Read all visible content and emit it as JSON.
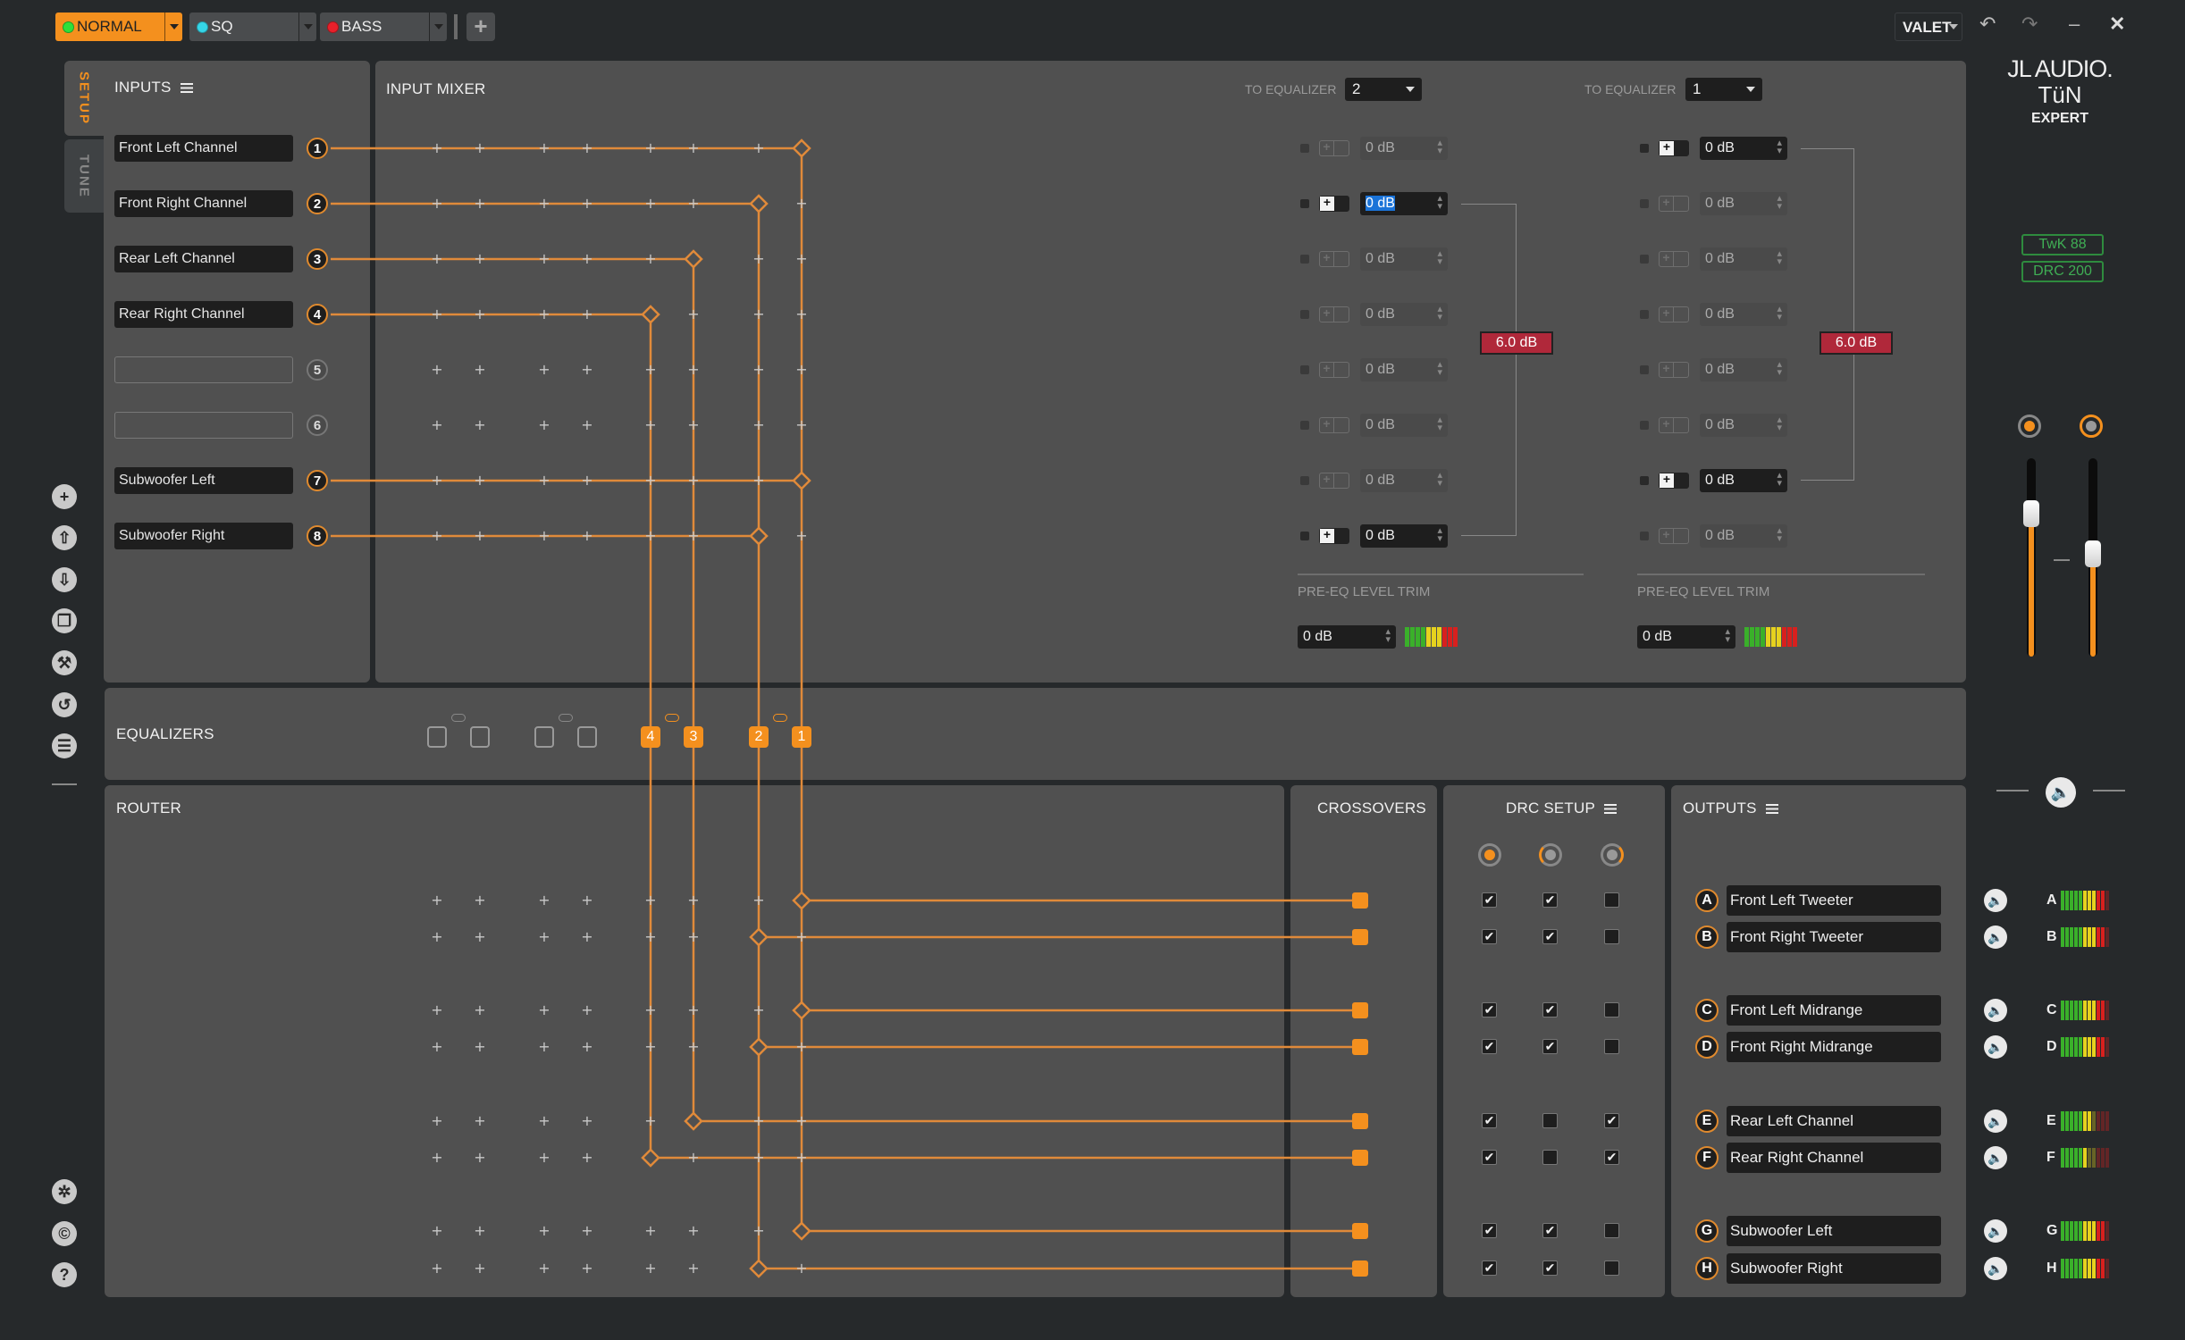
{
  "topbar": {
    "presets": [
      {
        "label": "NORMAL",
        "dot_color": "#2ee03a",
        "active": true
      },
      {
        "label": "SQ",
        "dot_color": "#35d6e8",
        "active": false
      },
      {
        "label": "BASS",
        "dot_color": "#e8202a",
        "active": false
      }
    ],
    "add_label": "+",
    "valet_label": "VALET",
    "undo_icon": "undo-icon",
    "redo_icon": "redo-icon",
    "minimize_label": "–",
    "close_label": "✕"
  },
  "brand": {
    "line1": "JL AUDIO.",
    "line2": "TüN",
    "line3": "EXPERT"
  },
  "device_badges": [
    "TwK 88",
    "DRC 200"
  ],
  "side_tabs": [
    {
      "label": "SETUP",
      "active": true
    },
    {
      "label": "TUNE",
      "active": false
    }
  ],
  "side_tools": [
    "add-icon",
    "upload-icon",
    "download-icon",
    "copy-icon",
    "wrench-icon",
    "reset-icon",
    "list-icon"
  ],
  "side_bottom": [
    {
      "icon": "settings-icon",
      "glyph": "✲"
    },
    {
      "icon": "copyright-icon",
      "glyph": "©"
    },
    {
      "icon": "help-icon",
      "glyph": "?"
    }
  ],
  "inputs": {
    "title": "INPUTS",
    "channels": [
      {
        "num": "1",
        "name": "Front Left Channel",
        "active": true
      },
      {
        "num": "2",
        "name": "Front Right Channel",
        "active": true
      },
      {
        "num": "3",
        "name": "Rear Left Channel",
        "active": true
      },
      {
        "num": "4",
        "name": "Rear Right Channel",
        "active": true
      },
      {
        "num": "5",
        "name": "",
        "active": false
      },
      {
        "num": "6",
        "name": "",
        "active": false
      },
      {
        "num": "7",
        "name": "Subwoofer Left",
        "active": true
      },
      {
        "num": "8",
        "name": "Subwoofer Right",
        "active": true
      }
    ]
  },
  "input_mixer": {
    "title": "INPUT MIXER",
    "groups": [
      {
        "to_label": "TO EQUALIZER",
        "selected": "2",
        "rows": [
          {
            "enabled": false,
            "value": "0 dB"
          },
          {
            "enabled": true,
            "value": "0 dB",
            "focused": true
          },
          {
            "enabled": false,
            "value": "0 dB"
          },
          {
            "enabled": false,
            "value": "0 dB"
          },
          {
            "enabled": false,
            "value": "0 dB"
          },
          {
            "enabled": false,
            "value": "0 dB"
          },
          {
            "enabled": false,
            "value": "0 dB"
          },
          {
            "enabled": true,
            "value": "0 dB"
          }
        ],
        "sum": "6.0 dB",
        "trim_label": "PRE-EQ LEVEL TRIM",
        "trim_value": "0 dB"
      },
      {
        "to_label": "TO EQUALIZER",
        "selected": "1",
        "rows": [
          {
            "enabled": true,
            "value": "0 dB"
          },
          {
            "enabled": false,
            "value": "0 dB"
          },
          {
            "enabled": false,
            "value": "0 dB"
          },
          {
            "enabled": false,
            "value": "0 dB"
          },
          {
            "enabled": false,
            "value": "0 dB"
          },
          {
            "enabled": false,
            "value": "0 dB"
          },
          {
            "enabled": true,
            "value": "0 dB"
          },
          {
            "enabled": false,
            "value": "0 dB"
          }
        ],
        "sum": "6.0 dB",
        "trim_label": "PRE-EQ LEVEL TRIM",
        "trim_value": "0 dB"
      }
    ]
  },
  "equalizers": {
    "title": "EQUALIZERS",
    "slots": [
      {
        "label": "",
        "active": false
      },
      {
        "label": "",
        "active": false
      },
      {
        "label": "",
        "active": false
      },
      {
        "label": "",
        "active": false
      },
      {
        "label": "4",
        "active": true
      },
      {
        "label": "3",
        "active": true
      },
      {
        "label": "2",
        "active": true
      },
      {
        "label": "1",
        "active": true
      }
    ],
    "links_active": [
      false,
      false,
      true,
      true
    ]
  },
  "routing": {
    "input_to_eq": {
      "1": "1",
      "2": "2",
      "3": "3",
      "4": "4",
      "7": "1",
      "8": "2"
    },
    "eq_to_output": {
      "A": "1",
      "B": "2",
      "C": "1",
      "D": "2",
      "E": "3",
      "F": "4",
      "G": "1",
      "H": "2"
    }
  },
  "router": {
    "title": "ROUTER"
  },
  "crossovers": {
    "title": "CROSSOVERS"
  },
  "drc_setup": {
    "title": "DRC SETUP",
    "knobs": [
      "low",
      "mid",
      "high"
    ],
    "checks": [
      [
        true,
        true,
        false
      ],
      [
        true,
        true,
        false
      ],
      [
        true,
        true,
        false
      ],
      [
        true,
        true,
        false
      ],
      [
        true,
        false,
        true
      ],
      [
        true,
        false,
        true
      ],
      [
        true,
        true,
        false
      ],
      [
        true,
        true,
        false
      ]
    ]
  },
  "outputs": {
    "title": "OUTPUTS",
    "channels": [
      {
        "letter": "A",
        "name": "Front Left Tweeter",
        "meter_level": 0.95
      },
      {
        "letter": "B",
        "name": "Front Right Tweeter",
        "meter_level": 0.95
      },
      {
        "letter": "C",
        "name": "Front Left Midrange",
        "meter_level": 0.95
      },
      {
        "letter": "D",
        "name": "Front Right Midrange",
        "meter_level": 0.95
      },
      {
        "letter": "E",
        "name": "Rear Left Channel",
        "meter_level": 0.6
      },
      {
        "letter": "F",
        "name": "Rear Right Channel",
        "meter_level": 0.5
      },
      {
        "letter": "G",
        "name": "Subwoofer Left",
        "meter_level": 0.95
      },
      {
        "letter": "H",
        "name": "Subwoofer Right",
        "meter_level": 0.95
      }
    ]
  },
  "master": {
    "slider1_level": 0.72,
    "slider2_level": 0.52,
    "mute_icon": "speaker-icon"
  }
}
